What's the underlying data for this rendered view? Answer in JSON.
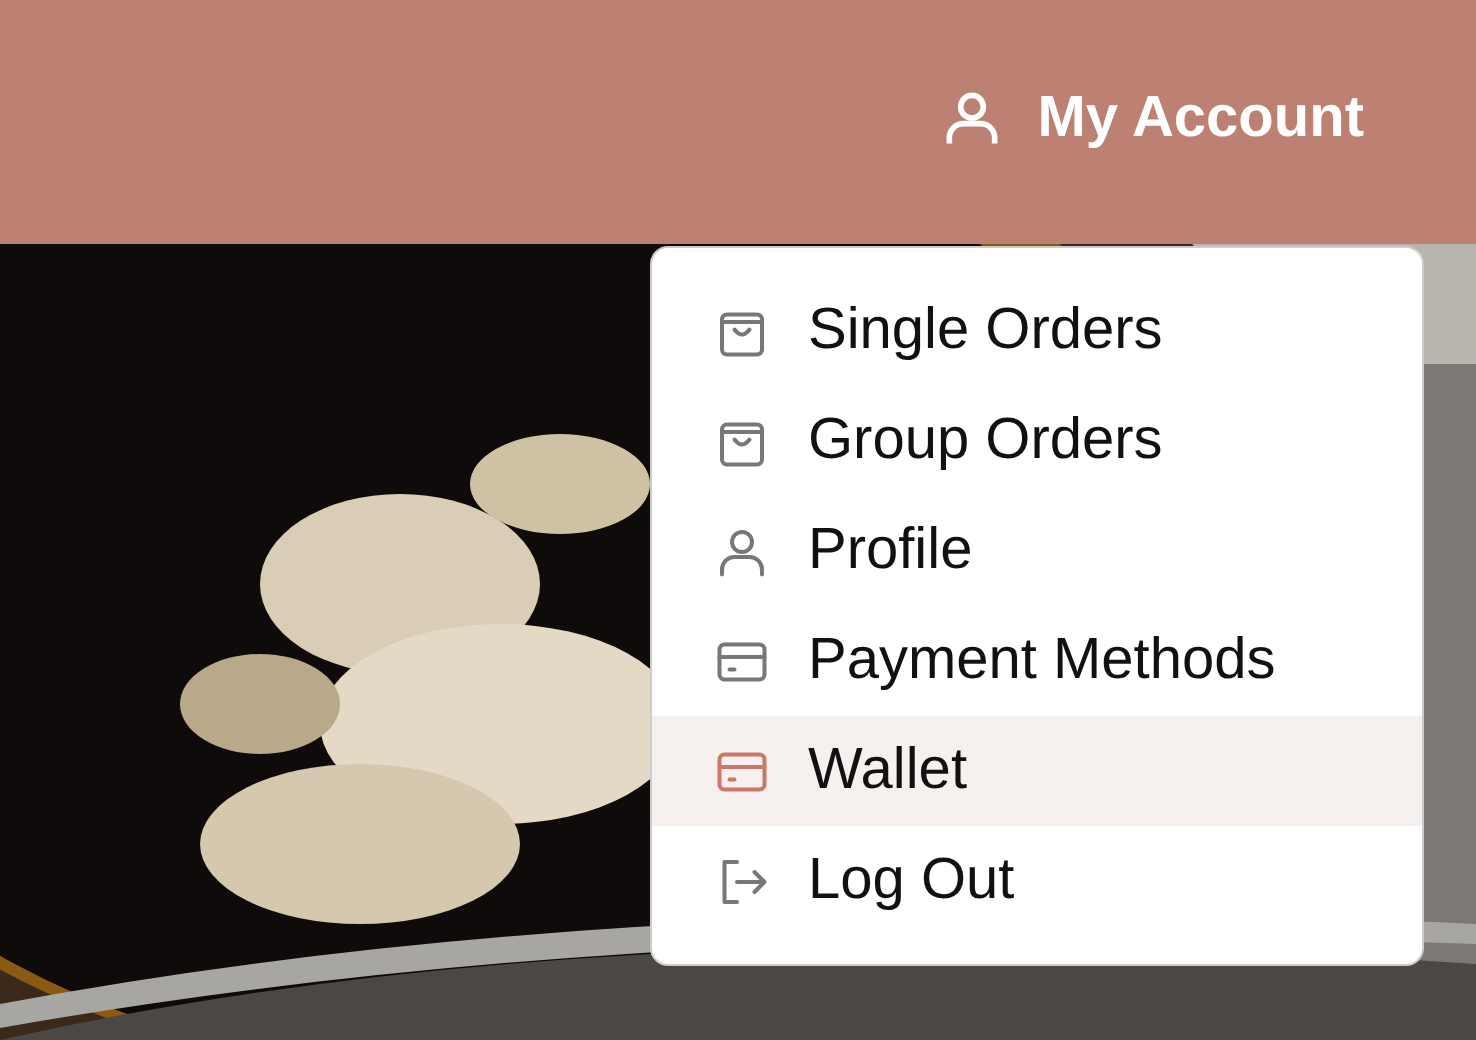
{
  "header": {
    "account_label": "My Account"
  },
  "menu": {
    "items": [
      {
        "label": "Single Orders",
        "kind": "bag",
        "selected": false
      },
      {
        "label": "Group Orders",
        "kind": "bag",
        "selected": false
      },
      {
        "label": "Profile",
        "kind": "user",
        "selected": false
      },
      {
        "label": "Payment Methods",
        "kind": "card",
        "selected": false
      },
      {
        "label": "Wallet",
        "kind": "card",
        "selected": true
      },
      {
        "label": "Log Out",
        "kind": "logout",
        "selected": false
      }
    ]
  }
}
